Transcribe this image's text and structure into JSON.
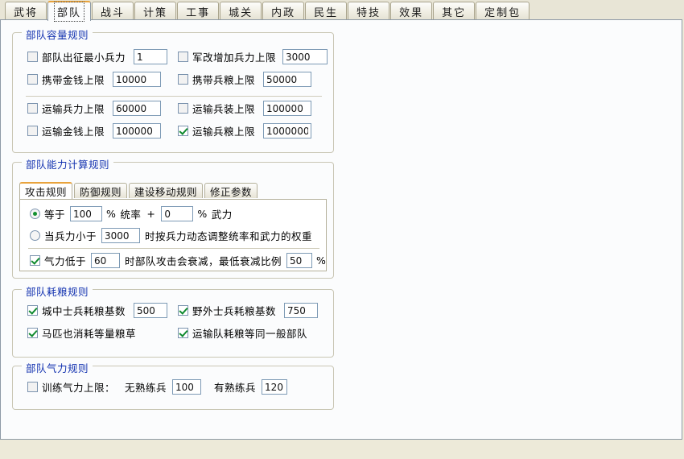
{
  "tabs": [
    {
      "label": "武将",
      "active": false
    },
    {
      "label": "部队",
      "active": true
    },
    {
      "label": "战斗",
      "active": false
    },
    {
      "label": "计策",
      "active": false
    },
    {
      "label": "工事",
      "active": false
    },
    {
      "label": "城关",
      "active": false
    },
    {
      "label": "内政",
      "active": false
    },
    {
      "label": "民生",
      "active": false
    },
    {
      "label": "特技",
      "active": false
    },
    {
      "label": "效果",
      "active": false
    },
    {
      "label": "其它",
      "active": false
    },
    {
      "label": "定制包",
      "active": false
    }
  ],
  "capacity_group": {
    "title": "部队容量规则",
    "rows": [
      {
        "label": "部队出征最小兵力",
        "checked": false,
        "value": "1"
      },
      {
        "label": "军改增加兵力上限",
        "checked": false,
        "value": "3000"
      },
      {
        "label": "携带金钱上限",
        "checked": false,
        "value": "10000"
      },
      {
        "label": "携带兵粮上限",
        "checked": false,
        "value": "50000"
      },
      {
        "label": "运输兵力上限",
        "checked": false,
        "value": "60000"
      },
      {
        "label": "运输兵装上限",
        "checked": false,
        "value": "100000"
      },
      {
        "label": "运输金钱上限",
        "checked": false,
        "value": "100000"
      },
      {
        "label": "运输兵粮上限",
        "checked": true,
        "value": "1000000"
      }
    ]
  },
  "ability_group": {
    "title": "部队能力计算规则",
    "tabs": [
      {
        "label": "攻击规则",
        "active": true
      },
      {
        "label": "防御规则",
        "active": false
      },
      {
        "label": "建设移动规则",
        "active": false
      },
      {
        "label": "修正参数",
        "active": false
      }
    ],
    "formula": {
      "selected": true,
      "prefix": "等于",
      "leader_value": "100",
      "pct1": "%",
      "leader_label": "统率",
      "plus": "+",
      "force_value": "0",
      "pct2": "%",
      "force_label": "武力"
    },
    "dynamic": {
      "selected": false,
      "prefix": "当兵力小于",
      "value": "3000",
      "suffix": "时按兵力动态调整统率和武力的权重"
    },
    "morale": {
      "checked": true,
      "prefix": "气力低于",
      "value": "60",
      "middle": "时部队攻击会衰减，最低衰减比例",
      "ratio": "50",
      "pct": "%"
    }
  },
  "food_group": {
    "title": "部队耗粮规则",
    "rows": [
      {
        "label": "城中士兵耗粮基数",
        "checked": true,
        "value": "500",
        "has_input": true
      },
      {
        "label": "野外士兵耗粮基数",
        "checked": true,
        "value": "750",
        "has_input": true
      },
      {
        "label": "马匹也消耗等量粮草",
        "checked": true,
        "value": "",
        "has_input": false
      },
      {
        "label": "运输队耗粮等同一般部队",
        "checked": true,
        "value": "",
        "has_input": false
      }
    ]
  },
  "morale_group": {
    "title": "部队气力规则",
    "row": {
      "checked": false,
      "label": "训练气力上限：",
      "untrained_label": "无熟练兵",
      "untrained_value": "100",
      "trained_label": "有熟练兵",
      "trained_value": "120"
    }
  },
  "colors": {
    "group_title": "#1433b0",
    "accent": "#e8a33d",
    "tabstrip_bg": "#e8e5d6",
    "panel_bg": "#fbfcfd",
    "check_green": "#0f8a2e",
    "input_border": "#7d9ab5"
  }
}
